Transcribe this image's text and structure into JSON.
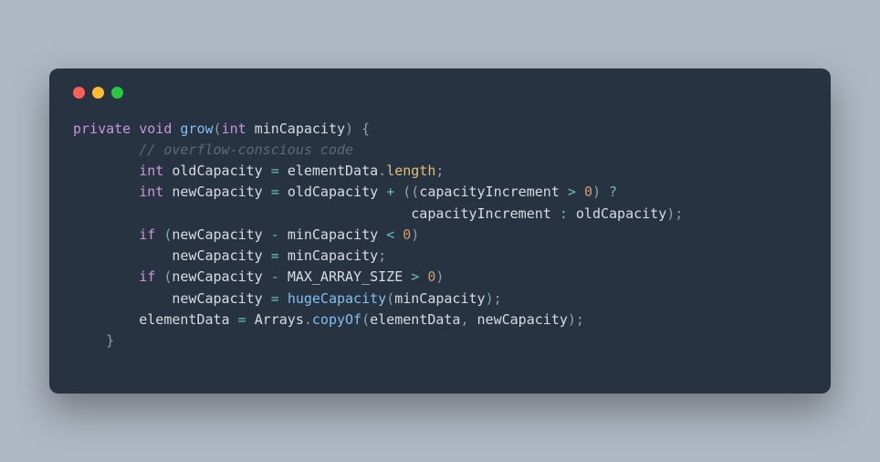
{
  "window": {
    "traffic_lights": [
      "red",
      "yellow",
      "green"
    ]
  },
  "code": {
    "tokens": [
      [
        {
          "t": "private",
          "c": "kw"
        },
        {
          "t": " ",
          "c": "punct"
        },
        {
          "t": "void",
          "c": "kw"
        },
        {
          "t": " ",
          "c": "punct"
        },
        {
          "t": "grow",
          "c": "fn"
        },
        {
          "t": "(",
          "c": "punct"
        },
        {
          "t": "int",
          "c": "kw"
        },
        {
          "t": " ",
          "c": "punct"
        },
        {
          "t": "minCapacity",
          "c": "ident"
        },
        {
          "t": ")",
          "c": "punct"
        },
        {
          "t": " ",
          "c": "punct"
        },
        {
          "t": "{",
          "c": "punct"
        }
      ],
      [
        {
          "t": "        ",
          "c": "punct"
        },
        {
          "t": "// overflow-conscious code",
          "c": "comment"
        }
      ],
      [
        {
          "t": "        ",
          "c": "punct"
        },
        {
          "t": "int",
          "c": "kw"
        },
        {
          "t": " ",
          "c": "punct"
        },
        {
          "t": "oldCapacity",
          "c": "ident"
        },
        {
          "t": " ",
          "c": "punct"
        },
        {
          "t": "=",
          "c": "op"
        },
        {
          "t": " ",
          "c": "punct"
        },
        {
          "t": "elementData",
          "c": "ident"
        },
        {
          "t": ".",
          "c": "punct"
        },
        {
          "t": "length",
          "c": "field"
        },
        {
          "t": ";",
          "c": "punct"
        }
      ],
      [
        {
          "t": "        ",
          "c": "punct"
        },
        {
          "t": "int",
          "c": "kw"
        },
        {
          "t": " ",
          "c": "punct"
        },
        {
          "t": "newCapacity",
          "c": "ident"
        },
        {
          "t": " ",
          "c": "punct"
        },
        {
          "t": "=",
          "c": "op"
        },
        {
          "t": " ",
          "c": "punct"
        },
        {
          "t": "oldCapacity",
          "c": "ident"
        },
        {
          "t": " ",
          "c": "punct"
        },
        {
          "t": "+",
          "c": "op"
        },
        {
          "t": " ",
          "c": "punct"
        },
        {
          "t": "((",
          "c": "punct"
        },
        {
          "t": "capacityIncrement",
          "c": "ident"
        },
        {
          "t": " ",
          "c": "punct"
        },
        {
          "t": ">",
          "c": "op"
        },
        {
          "t": " ",
          "c": "punct"
        },
        {
          "t": "0",
          "c": "num"
        },
        {
          "t": ")",
          "c": "punct"
        },
        {
          "t": " ",
          "c": "punct"
        },
        {
          "t": "?",
          "c": "op"
        }
      ],
      [
        {
          "t": "                                         ",
          "c": "punct"
        },
        {
          "t": "capacityIncrement",
          "c": "ident"
        },
        {
          "t": " ",
          "c": "punct"
        },
        {
          "t": ":",
          "c": "op"
        },
        {
          "t": " ",
          "c": "punct"
        },
        {
          "t": "oldCapacity",
          "c": "ident"
        },
        {
          "t": ");",
          "c": "punct"
        }
      ],
      [
        {
          "t": "        ",
          "c": "punct"
        },
        {
          "t": "if",
          "c": "kw"
        },
        {
          "t": " ",
          "c": "punct"
        },
        {
          "t": "(",
          "c": "punct"
        },
        {
          "t": "newCapacity",
          "c": "ident"
        },
        {
          "t": " ",
          "c": "punct"
        },
        {
          "t": "-",
          "c": "op"
        },
        {
          "t": " ",
          "c": "punct"
        },
        {
          "t": "minCapacity",
          "c": "ident"
        },
        {
          "t": " ",
          "c": "punct"
        },
        {
          "t": "<",
          "c": "op"
        },
        {
          "t": " ",
          "c": "punct"
        },
        {
          "t": "0",
          "c": "num"
        },
        {
          "t": ")",
          "c": "punct"
        }
      ],
      [
        {
          "t": "            ",
          "c": "punct"
        },
        {
          "t": "newCapacity",
          "c": "ident"
        },
        {
          "t": " ",
          "c": "punct"
        },
        {
          "t": "=",
          "c": "op"
        },
        {
          "t": " ",
          "c": "punct"
        },
        {
          "t": "minCapacity",
          "c": "ident"
        },
        {
          "t": ";",
          "c": "punct"
        }
      ],
      [
        {
          "t": "        ",
          "c": "punct"
        },
        {
          "t": "if",
          "c": "kw"
        },
        {
          "t": " ",
          "c": "punct"
        },
        {
          "t": "(",
          "c": "punct"
        },
        {
          "t": "newCapacity",
          "c": "ident"
        },
        {
          "t": " ",
          "c": "punct"
        },
        {
          "t": "-",
          "c": "op"
        },
        {
          "t": " ",
          "c": "punct"
        },
        {
          "t": "MAX_ARRAY_SIZE",
          "c": "const"
        },
        {
          "t": " ",
          "c": "punct"
        },
        {
          "t": ">",
          "c": "op"
        },
        {
          "t": " ",
          "c": "punct"
        },
        {
          "t": "0",
          "c": "num"
        },
        {
          "t": ")",
          "c": "punct"
        }
      ],
      [
        {
          "t": "            ",
          "c": "punct"
        },
        {
          "t": "newCapacity",
          "c": "ident"
        },
        {
          "t": " ",
          "c": "punct"
        },
        {
          "t": "=",
          "c": "op"
        },
        {
          "t": " ",
          "c": "punct"
        },
        {
          "t": "hugeCapacity",
          "c": "fn"
        },
        {
          "t": "(",
          "c": "punct"
        },
        {
          "t": "minCapacity",
          "c": "ident"
        },
        {
          "t": ");",
          "c": "punct"
        }
      ],
      [
        {
          "t": "        ",
          "c": "punct"
        },
        {
          "t": "elementData",
          "c": "ident"
        },
        {
          "t": " ",
          "c": "punct"
        },
        {
          "t": "=",
          "c": "op"
        },
        {
          "t": " ",
          "c": "punct"
        },
        {
          "t": "Arrays",
          "c": "ident"
        },
        {
          "t": ".",
          "c": "punct"
        },
        {
          "t": "copyOf",
          "c": "fn"
        },
        {
          "t": "(",
          "c": "punct"
        },
        {
          "t": "elementData",
          "c": "ident"
        },
        {
          "t": ",",
          "c": "punct"
        },
        {
          "t": " ",
          "c": "punct"
        },
        {
          "t": "newCapacity",
          "c": "ident"
        },
        {
          "t": ");",
          "c": "punct"
        }
      ],
      [
        {
          "t": "    ",
          "c": "punct"
        },
        {
          "t": "}",
          "c": "punct"
        }
      ]
    ]
  }
}
